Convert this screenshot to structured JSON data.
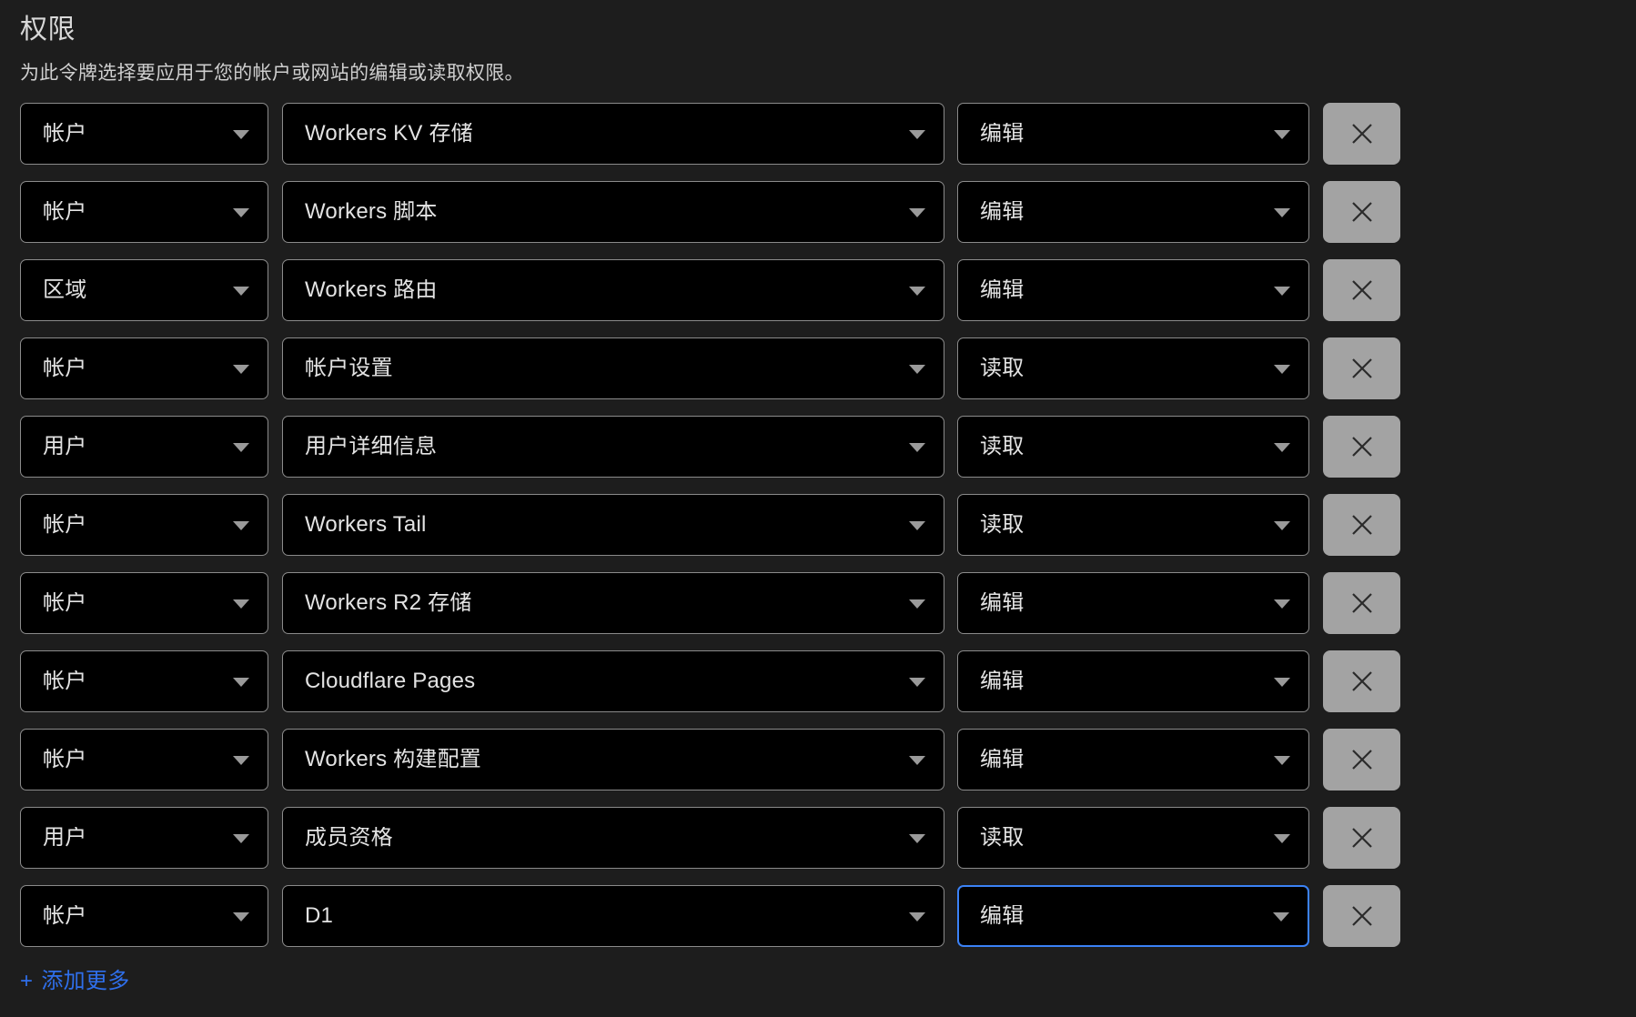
{
  "section": {
    "title": "权限",
    "description": "为此令牌选择要应用于您的帐户或网站的编辑或读取权限。"
  },
  "colors": {
    "background": "#1d1d1d",
    "field_background": "#000000",
    "field_border": "#8b8b8b",
    "focus_border": "#3b82f6",
    "remove_button": "#a3a3a3",
    "link": "#2f6feb",
    "text": "#e3e3e3"
  },
  "icons": {
    "caret": "chevron-down-icon",
    "remove": "close-icon",
    "add": "plus-icon"
  },
  "rows": [
    {
      "scope": "帐户",
      "resource": "Workers KV 存储",
      "permission": "编辑",
      "focused": false
    },
    {
      "scope": "帐户",
      "resource": "Workers 脚本",
      "permission": "编辑",
      "focused": false
    },
    {
      "scope": "区域",
      "resource": "Workers 路由",
      "permission": "编辑",
      "focused": false
    },
    {
      "scope": "帐户",
      "resource": "帐户设置",
      "permission": "读取",
      "focused": false
    },
    {
      "scope": "用户",
      "resource": "用户详细信息",
      "permission": "读取",
      "focused": false
    },
    {
      "scope": "帐户",
      "resource": "Workers Tail",
      "permission": "读取",
      "focused": false
    },
    {
      "scope": "帐户",
      "resource": "Workers R2 存储",
      "permission": "编辑",
      "focused": false
    },
    {
      "scope": "帐户",
      "resource": "Cloudflare Pages",
      "permission": "编辑",
      "focused": false
    },
    {
      "scope": "帐户",
      "resource": "Workers 构建配置",
      "permission": "编辑",
      "focused": false
    },
    {
      "scope": "用户",
      "resource": "成员资格",
      "permission": "读取",
      "focused": false
    },
    {
      "scope": "帐户",
      "resource": "D1",
      "permission": "编辑",
      "focused": true
    }
  ],
  "add_more": {
    "plus": "+",
    "label": "添加更多"
  }
}
